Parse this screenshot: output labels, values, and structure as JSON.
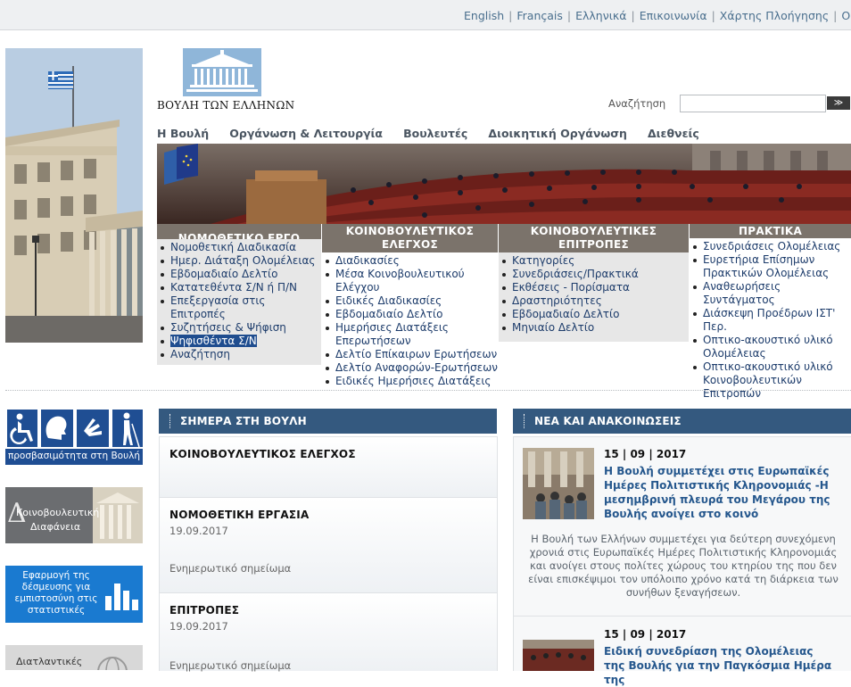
{
  "top_links": [
    "English",
    "Français",
    "Ελληνικά",
    "Επικοινωνία",
    "Χάρτης Πλοήγησης",
    "Οδηγίες"
  ],
  "logo": {
    "text": "ΒΟΥΛΗ ΤΩΝ ΕΛΛΗΝΩΝ"
  },
  "search": {
    "label": "Αναζήτηση",
    "value": "",
    "button": "≫"
  },
  "main_nav": [
    "Η Βουλή",
    "Οργάνωση & Λειτουργία",
    "Βουλευτές",
    "Διοικητική Οργάνωση",
    "Διεθνείς"
  ],
  "columns": [
    {
      "title": "ΝΟΜΟΘΕΤΙΚΟ ΕΡΓΟ",
      "items": [
        "Νομοθετική Διαδικασία",
        "Ημερ. Διάταξη Ολομέλειας",
        "Εβδομαδιαίο Δελτίο",
        "Κατατεθέντα Σ/Ν ή Π/Ν",
        "Επεξεργασία στις Επιτροπές",
        "Συζητήσεις & Ψήφιση",
        "Ψηφισθέντα Σ/Ν",
        "Αναζήτηση"
      ]
    },
    {
      "title": "ΚΟΙΝΟΒΟΥΛΕΥΤΙΚΟΣ ΕΛΕΓΧΟΣ",
      "items": [
        "Διαδικασίες",
        "Μέσα Κοινοβουλευτικού Ελέγχου",
        "Ειδικές Διαδικασίες",
        "Εβδομαδιαίο Δελτίο",
        "Ημερήσιες Διατάξεις Επερωτήσεων",
        "Δελτίο Επίκαιρων Ερωτήσεων",
        "Δελτίο Αναφορών-Ερωτήσεων",
        "Ειδικές Ημερήσιες Διατάξεις"
      ]
    },
    {
      "title": "ΚΟΙΝΟΒΟΥΛΕΥΤΙΚΕΣ ΕΠΙΤΡΟΠΕΣ",
      "items": [
        "Κατηγορίες",
        "Συνεδριάσεις/Πρακτικά",
        "Εκθέσεις - Πορίσματα",
        "Δραστηριότητες",
        "Εβδομαδιαίο Δελτίο",
        "Μηνιαίο Δελτίο"
      ]
    },
    {
      "title": "ΠΡΑΚΤΙΚΑ",
      "items": [
        "Συνεδριάσεις Ολομέλειας",
        "Ευρετήρια Επίσημων Πρακτικών Ολομέλειας",
        "Αναθεωρήσεις Συντάγματος",
        "Διάσκεψη Προέδρων ΙΣΤ' Περ.",
        "Οπτικο-ακουστικό υλικό Ολομέλειας",
        "Οπτικο-ακουστικό υλικό Κοινοβουλευτικών Επιτροπών"
      ]
    }
  ],
  "side_banners": {
    "accessibility": "προσβασιμότητα στη Βουλή",
    "transparency_1": "Κοινοβουλευτική",
    "transparency_2": "Διαφάνεια",
    "statistics": "Εφαρμογή της δέσμευσης για εμπιστοσύνη στις στατιστικές",
    "international": "Διατλαντικές"
  },
  "today": {
    "title": "ΣΗΜΕΡΑ ΣΤΗ ΒΟΥΛΗ",
    "items": [
      {
        "title": "ΚΟΙΝΟΒΟΥΛΕΥΤΙΚΟΣ ΕΛΕΓΧΟΣ"
      },
      {
        "title": "ΝΟΜΟΘΕΤΙΚΗ ΕΡΓΑΣΙΑ",
        "date": "19.09.2017",
        "link": "Ενημερωτικό σημείωμα"
      },
      {
        "title": "ΕΠΙΤΡΟΠΕΣ",
        "date": "19.09.2017",
        "link": "Ενημερωτικό σημείωμα"
      }
    ]
  },
  "news": {
    "title": "ΝΕΑ ΚΑΙ ΑΝΑΚΟΙΝΩΣΕΙΣ",
    "items": [
      {
        "date": "15 | 09 | 2017",
        "title": "Η Βουλή συμμετέχει στις Ευρωπαϊκές Ημέρες Πολιτιστικής Κληρονομιάς -Η μεσημβρινή πλευρά του Μεγάρου της Βουλής ανοίγει στο κοινό",
        "summary": "Η Βουλή των Ελλήνων συμμετέχει για δεύτερη συνεχόμενη χρονιά στις Ευρωπαϊκές Ημέρες Πολιτιστικής Κληρονομιάς και ανοίγει στους πολίτες χώρους του κτηρίου της που δεν είναι επισκέψιμοι τον υπόλοιπο χρόνο κατά τη διάρκεια των συνήθων ξεναγήσεων."
      },
      {
        "date": "15 | 09 | 2017",
        "title": "Ειδική συνεδρίαση της Ολομέλειας της Βουλής για την Παγκόσμια Ημέρα της"
      }
    ]
  }
}
